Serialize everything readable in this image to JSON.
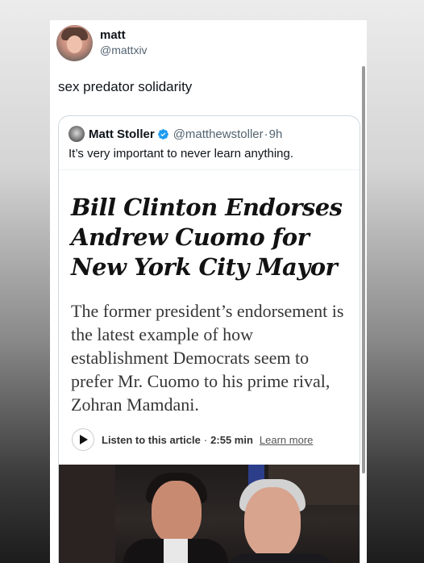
{
  "tweet": {
    "display_name": "matt",
    "handle": "@mattxiv",
    "text": "sex predator solidarity"
  },
  "quote": {
    "display_name": "Matt Stoller",
    "handle": "@matthewstoller",
    "separator": "·",
    "time": "9h",
    "text": "It’s very important to never learn anything.",
    "verified_color": "#1d9bf0"
  },
  "article": {
    "headline": "Bill Clinton Endorses Andrew Cuomo for New York City Mayor",
    "summary": "The former president’s endorsement is the latest example of how establishment Democrats seem to prefer Mr. Cuomo to his prime rival, Zohran Mamdani.",
    "listen_label": "Listen to this article",
    "listen_separator": "·",
    "listen_duration": "2:55 min",
    "learn_more": "Learn more"
  },
  "icons": {
    "avatar": "user-avatar",
    "quote_avatar": "quoted-user-avatar",
    "verified": "verified-badge-icon",
    "play": "play-icon"
  }
}
